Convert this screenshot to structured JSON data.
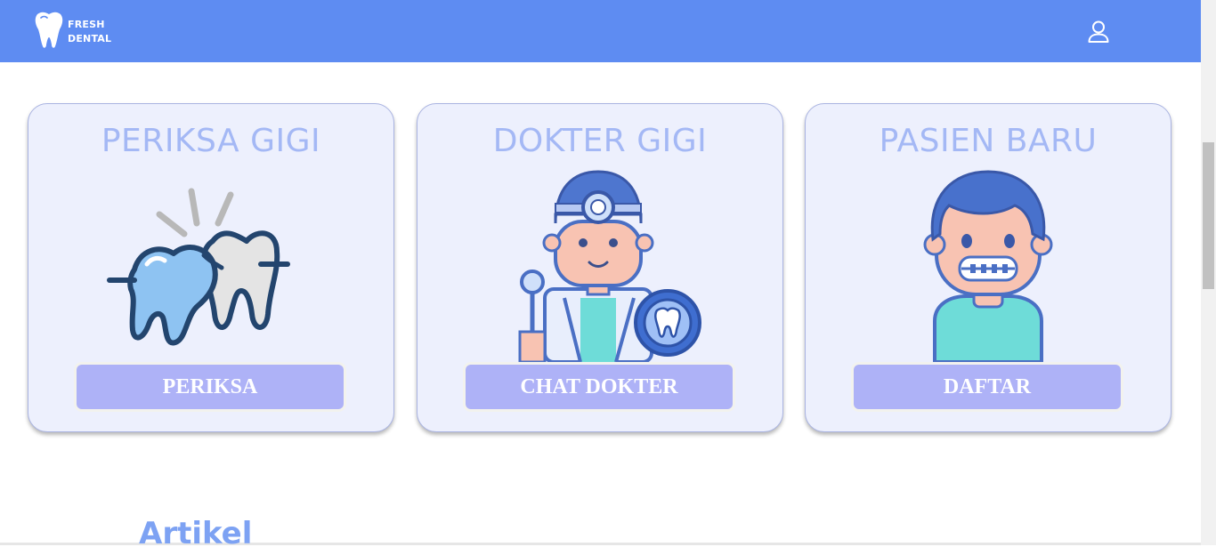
{
  "app": {
    "brand_line1": "FRESH",
    "brand_line2": "DENTAL",
    "brand_logo_icon": "tooth-icon",
    "user_icon": "user-icon"
  },
  "cards": [
    {
      "title": "PERIKSA GIGI",
      "button_label": "PERIKSA",
      "illustration": "teeth-checkup-icon"
    },
    {
      "title": "DOKTER GIGI",
      "button_label": "CHAT DOKTER",
      "illustration": "dentist-doctor-icon"
    },
    {
      "title": "PASIEN BARU",
      "button_label": "DAFTAR",
      "illustration": "patient-braces-icon"
    }
  ],
  "section": {
    "title": "Artikel"
  },
  "colors": {
    "navbar": "#5e8cf2",
    "card_bg": "#edf0fd",
    "card_title": "#a4b8f5",
    "button_bg": "#aeb2f7",
    "section_title": "#7da2f3"
  }
}
